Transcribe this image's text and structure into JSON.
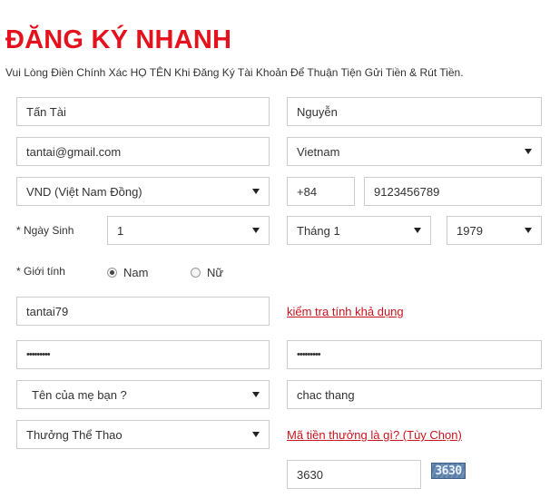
{
  "header": {
    "title": "ĐĂNG KÝ NHANH",
    "subtitle": "Vui Lòng Điền Chính Xác HỌ TÊN Khi Đăng Ký Tài Khoản Để Thuận Tiện Gửi Tiền & Rút Tiền."
  },
  "form": {
    "first_name": "Tấn Tài",
    "last_name": "Nguyễn",
    "email": "tantai@gmail.com",
    "country": "Vietnam",
    "currency": "VND (Việt Nam Đồng)",
    "phone_code": "+84",
    "phone_number": "9123456789",
    "birthdate_label": "* Ngày Sinh",
    "birth_day": "1",
    "birth_month": "Tháng 1",
    "birth_year": "1979",
    "gender_label": "* Giới tính",
    "gender_male": "Nam",
    "gender_female": "Nữ",
    "gender_selected": "male",
    "username": "tantai79",
    "check_availability_link": "kiểm tra tính khả dụng",
    "password": "•••••••••",
    "confirm_password": "•••••••••",
    "security_question": "Tên của mẹ bạn ?",
    "security_answer": "chac thang",
    "bonus_type": "Thưởng Thể Thao",
    "bonus_code_link": "Mã tiền thưởng là gì? (Tùy Chọn)",
    "captcha_input": "3630",
    "captcha_image_text": "3630"
  },
  "icons": {
    "dropdown": "caret-down-icon",
    "radio": "radio-button-icon"
  },
  "colors": {
    "title": "#e4121c",
    "link": "#c9141d",
    "border": "#cccccc",
    "captcha_bg": "#5a7fa8"
  }
}
